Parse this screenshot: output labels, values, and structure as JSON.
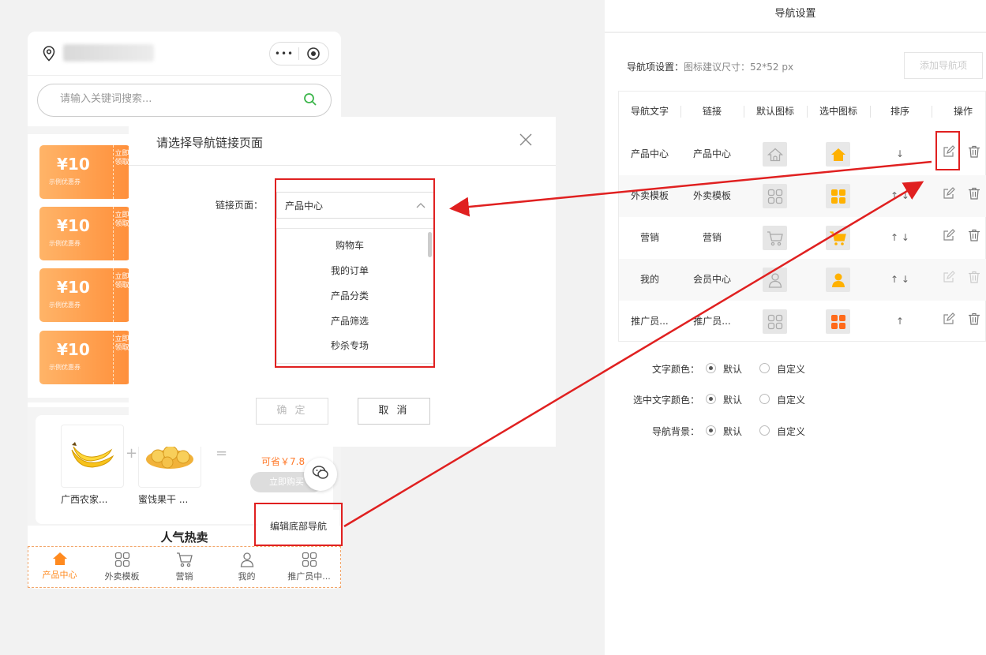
{
  "phone": {
    "search_placeholder": "请输入关键词搜索...",
    "coupons": [
      {
        "amount": "¥10",
        "desc": "示例优惠券",
        "side": "立即领取"
      },
      {
        "amount": "¥10",
        "desc": "示例优惠券",
        "side": "立即领取"
      },
      {
        "amount": "¥10",
        "desc": "示例优惠券",
        "side": "立即领取"
      },
      {
        "amount": "¥10",
        "desc": "示例优惠券",
        "side": "立即领取"
      }
    ],
    "combo": {
      "product1": "广西农家...",
      "product2": "蜜饯果干 ...",
      "plus": "+",
      "equals": "=",
      "save": "可省￥7.8",
      "buy": "立即购买"
    },
    "section_title": "人气热卖",
    "edit_nav": "编辑底部导航",
    "tabbar": [
      {
        "label": "产品中心",
        "icon": "home-icon",
        "active": true
      },
      {
        "label": "外卖模板",
        "icon": "grid-icon",
        "active": false
      },
      {
        "label": "营销",
        "icon": "cart-icon",
        "active": false
      },
      {
        "label": "我的",
        "icon": "user-icon",
        "active": false
      },
      {
        "label": "推广员中...",
        "icon": "grid-icon",
        "active": false
      }
    ]
  },
  "modal": {
    "title": "请选择导航链接页面",
    "field_label": "链接页面：",
    "selected": "产品中心",
    "options": [
      "购物车",
      "我的订单",
      "产品分类",
      "产品筛选",
      "秒杀专场"
    ],
    "ok": "确 定",
    "cancel": "取 消"
  },
  "panel": {
    "title": "导航设置",
    "nav_title": "导航项设置：",
    "nav_hint": "图标建议尺寸：52*52 px",
    "add_button": "添加导航项",
    "headers": [
      "导航文字",
      "链接",
      "默认图标",
      "选中图标",
      "排序",
      "操作"
    ],
    "rows": [
      {
        "text": "产品中心",
        "link": "产品中心",
        "icon": "home-icon",
        "sort": "↓",
        "sel_color": "#ffb100"
      },
      {
        "text": "外卖模板",
        "link": "外卖模板",
        "icon": "grid-icon",
        "sort": "↑ ↓",
        "sel_color": "#ffb100"
      },
      {
        "text": "营销",
        "link": "营销",
        "icon": "cart-icon",
        "sort": "↑ ↓",
        "sel_color": "#ffb100"
      },
      {
        "text": "我的",
        "link": "会员中心",
        "icon": "user-icon",
        "sort": "↑ ↓",
        "sel_color": "#ffb100"
      },
      {
        "text": "推广员...",
        "link": "推广员...",
        "icon": "grid-icon",
        "sort": "↑",
        "sel_color": "#ff6a1a"
      }
    ],
    "settings": [
      {
        "label": "文字颜色：",
        "opt1": "默认",
        "opt2": "自定义"
      },
      {
        "label": "选中文字颜色：",
        "opt1": "默认",
        "opt2": "自定义"
      },
      {
        "label": "导航背景：",
        "opt1": "默认",
        "opt2": "自定义"
      }
    ]
  },
  "colors": {
    "accent": "#ff8a1f",
    "annotation": "#e02020"
  }
}
